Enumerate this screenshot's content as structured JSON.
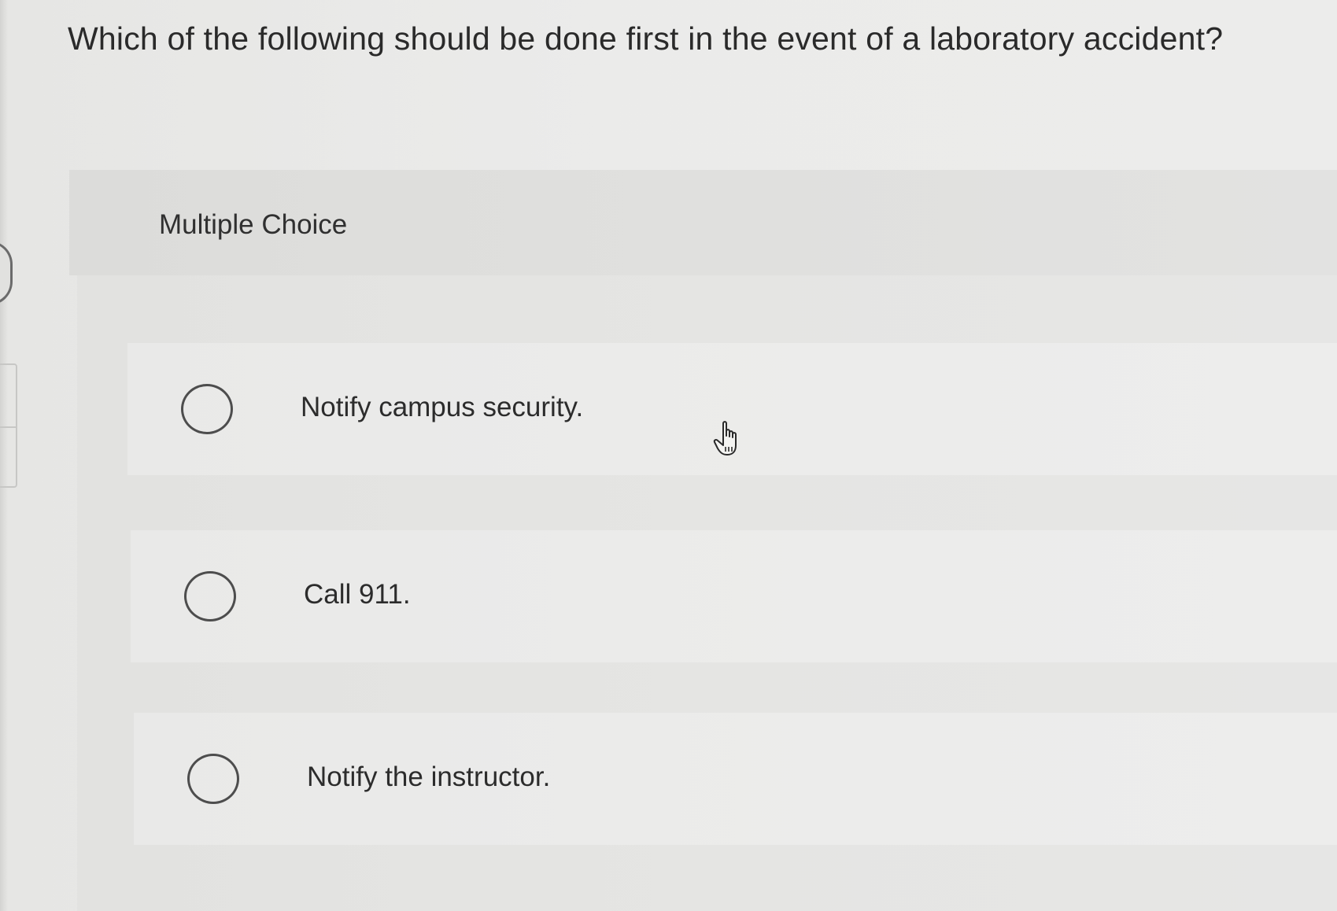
{
  "question": {
    "text": "Which of the following should be done first in the event of a laboratory accident?"
  },
  "multiple_choice": {
    "label": "Multiple Choice",
    "options": [
      {
        "label": "Notify campus security.",
        "selected": false
      },
      {
        "label": "Call 911.",
        "selected": false
      },
      {
        "label": "Notify the instructor.",
        "selected": false
      }
    ]
  },
  "icons": {
    "radio": "radio-unchecked-icon",
    "cursor": "hand-pointer-cursor-icon"
  },
  "colors": {
    "background": "#ebebea",
    "panel": "#e0e0de",
    "text": "#2b2b2b",
    "radio_border": "#4d4d4d"
  }
}
